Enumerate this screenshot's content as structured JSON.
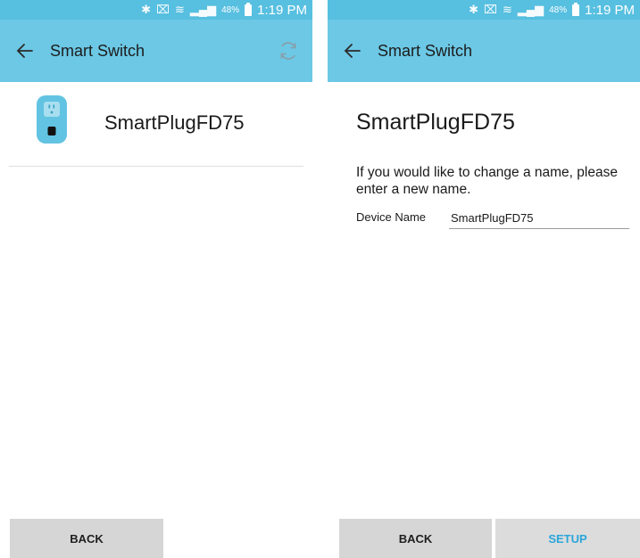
{
  "status_bar": {
    "battery_percent": "48%",
    "time": "1:19 PM"
  },
  "left_screen": {
    "toolbar_title": "Smart Switch",
    "device_name": "SmartPlugFD75",
    "back_label": "BACK"
  },
  "right_screen": {
    "toolbar_title": "Smart Switch",
    "device_title": "SmartPlugFD75",
    "prompt": "If you would like to change a name, please enter a new name.",
    "field_label": "Device Name",
    "field_value": "SmartPlugFD75",
    "back_label": "BACK",
    "setup_label": "SETUP"
  },
  "colors": {
    "status_bar": "#57bfe0",
    "toolbar": "#6cc8e5",
    "button_bg": "#d6d6d6",
    "setup_text": "#2aa6da"
  }
}
